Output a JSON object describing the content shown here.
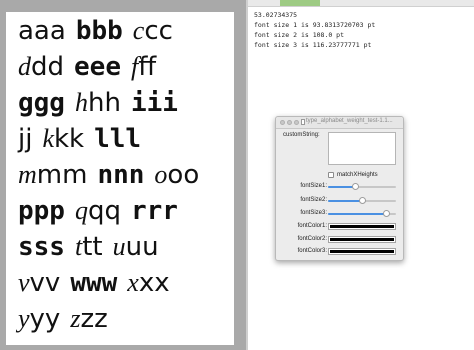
{
  "canvas": {
    "rows": [
      {
        "groups": [
          {
            "text": "aa",
            "style": "f1"
          },
          {
            "text": "a",
            "style": "f1"
          },
          {
            "text": "bbb",
            "style": "f2"
          },
          {
            "text": "c",
            "style": "f3"
          },
          {
            "text": "cc",
            "style": "f1"
          }
        ]
      },
      {
        "groups": [
          {
            "text": "d",
            "style": "f3"
          },
          {
            "text": "dd",
            "style": "f1"
          },
          {
            "text": "eee",
            "style": "f2"
          },
          {
            "text": "f",
            "style": "f3"
          },
          {
            "text": "ff",
            "style": "f1"
          }
        ]
      },
      {
        "groups": [
          {
            "text": "ggg",
            "style": "f2"
          },
          {
            "text": "h",
            "style": "f3"
          },
          {
            "text": "hh",
            "style": "f1"
          },
          {
            "text": "iii",
            "style": "f2"
          }
        ]
      },
      {
        "groups": [
          {
            "text": "jj",
            "style": "f1"
          },
          {
            "text": "k",
            "style": "f3"
          },
          {
            "text": "kk",
            "style": "f1"
          },
          {
            "text": "lll",
            "style": "f2"
          }
        ]
      },
      {
        "groups": [
          {
            "text": "m",
            "style": "f3"
          },
          {
            "text": "mm",
            "style": "f1"
          },
          {
            "text": "nnn",
            "style": "f2"
          },
          {
            "text": "o",
            "style": "f3"
          },
          {
            "text": "oo",
            "style": "f1"
          }
        ]
      },
      {
        "groups": [
          {
            "text": "ppp",
            "style": "f2"
          },
          {
            "text": "q",
            "style": "f3"
          },
          {
            "text": "qq",
            "style": "f1"
          },
          {
            "text": "rrr",
            "style": "f2"
          }
        ]
      },
      {
        "groups": [
          {
            "text": "sss",
            "style": "f2"
          },
          {
            "text": "t",
            "style": "f3"
          },
          {
            "text": "tt",
            "style": "f1"
          },
          {
            "text": "u",
            "style": "f3"
          },
          {
            "text": "uu",
            "style": "f1"
          }
        ]
      },
      {
        "groups": [
          {
            "text": "v",
            "style": "f3"
          },
          {
            "text": "vv",
            "style": "f1"
          },
          {
            "text": "www",
            "style": "f2"
          },
          {
            "text": "x",
            "style": "f3"
          },
          {
            "text": "xx",
            "style": "f1"
          }
        ]
      },
      {
        "groups": [
          {
            "text": "y",
            "style": "f3"
          },
          {
            "text": "yy",
            "style": "f1"
          },
          {
            "text": "z",
            "style": "f3"
          },
          {
            "text": "zz",
            "style": "f1"
          }
        ]
      }
    ]
  },
  "console": {
    "lines": [
      "53.02734375",
      "font size 1 is 93.8313720703 pt",
      "font size 2 is 108.0 pt",
      "font size 3 is 116.23777771 pt"
    ]
  },
  "window": {
    "title": "type_alphabet_weight_test-1.1..."
  },
  "controls": {
    "custom_string_label": "customString:",
    "custom_string_value": "",
    "match_x_heights_label": "matchXHeights",
    "match_x_heights_checked": false,
    "font_size_1_label": "fontSize1:",
    "font_size_2_label": "fontSize2:",
    "font_size_3_label": "fontSize3:",
    "font_size_1_fraction": 0.4,
    "font_size_2_fraction": 0.5,
    "font_size_3_fraction": 0.85,
    "font_color_1_label": "fontColor1:",
    "font_color_2_label": "fontColor2:",
    "font_color_3_label": "fontColor3:",
    "font_color_1": "#000000",
    "font_color_2": "#000000",
    "font_color_3": "#000000",
    "slider_accent": "#4a90e2"
  }
}
